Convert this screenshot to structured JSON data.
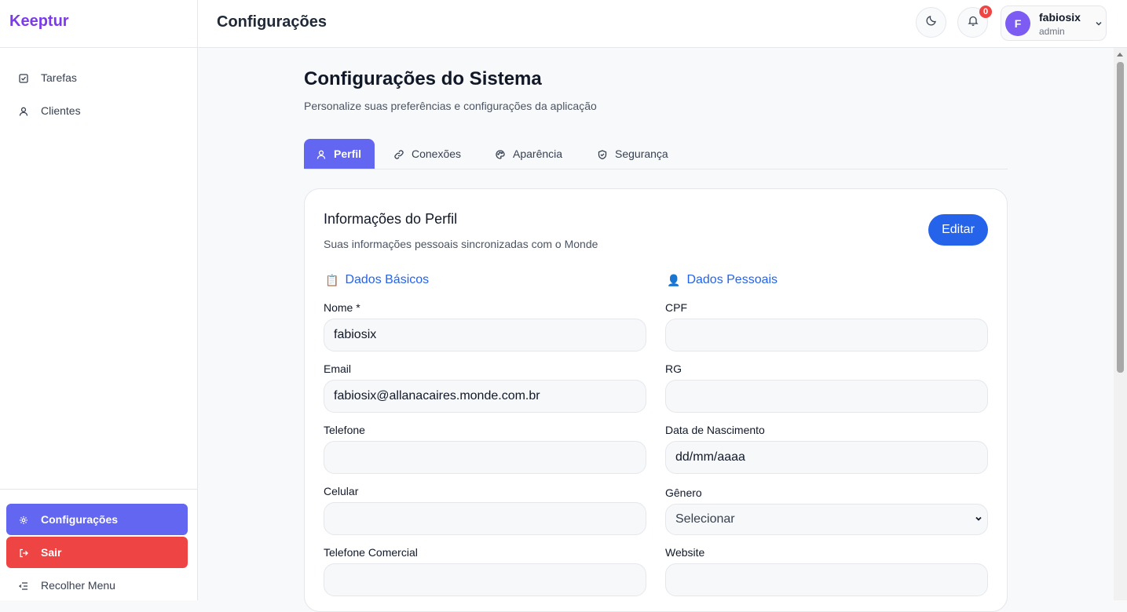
{
  "app": {
    "brand": "Keeptur"
  },
  "sidebar": {
    "items": [
      {
        "label": "Tarefas",
        "icon": "check-square-icon"
      },
      {
        "label": "Clientes",
        "icon": "user-icon"
      }
    ],
    "bottom": {
      "config_label": "Configurações",
      "logout_label": "Sair",
      "collapse_label": "Recolher Menu"
    }
  },
  "topbar": {
    "title": "Configurações",
    "notifications_count": "0",
    "user": {
      "initial": "F",
      "name": "fabiosix",
      "role": "admin"
    }
  },
  "page": {
    "title": "Configurações do Sistema",
    "subtitle": "Personalize suas preferências e configurações da aplicação"
  },
  "tabs": [
    {
      "label": "Perfil",
      "icon": "user-icon",
      "active": true
    },
    {
      "label": "Conexões",
      "icon": "link-icon",
      "active": false
    },
    {
      "label": "Aparência",
      "icon": "palette-icon",
      "active": false
    },
    {
      "label": "Segurança",
      "icon": "shield-icon",
      "active": false
    }
  ],
  "profile": {
    "title": "Informações do Perfil",
    "subtitle": "Suas informações pessoais sincronizadas com o Monde",
    "edit_label": "Editar",
    "basic": {
      "emoji": "📋",
      "title": "Dados Básicos",
      "fields": [
        {
          "label": "Nome *",
          "value": "fabiosix"
        },
        {
          "label": "Email",
          "value": "fabiosix@allanacaires.monde.com.br"
        },
        {
          "label": "Telefone",
          "value": ""
        },
        {
          "label": "Celular",
          "value": ""
        },
        {
          "label": "Telefone Comercial",
          "value": ""
        }
      ]
    },
    "personal": {
      "emoji": "👤",
      "title": "Dados Pessoais",
      "fields": [
        {
          "label": "CPF",
          "value": ""
        },
        {
          "label": "RG",
          "value": ""
        },
        {
          "label": "Data de Nascimento",
          "value": "dd/mm/aaaa"
        },
        {
          "label": "Gênero",
          "value": "Selecionar"
        },
        {
          "label": "Website",
          "value": ""
        }
      ]
    }
  },
  "colors": {
    "brand": "#7c3aed",
    "accent": "#6366f1",
    "danger": "#ef4444",
    "primary_button": "#2563eb"
  }
}
